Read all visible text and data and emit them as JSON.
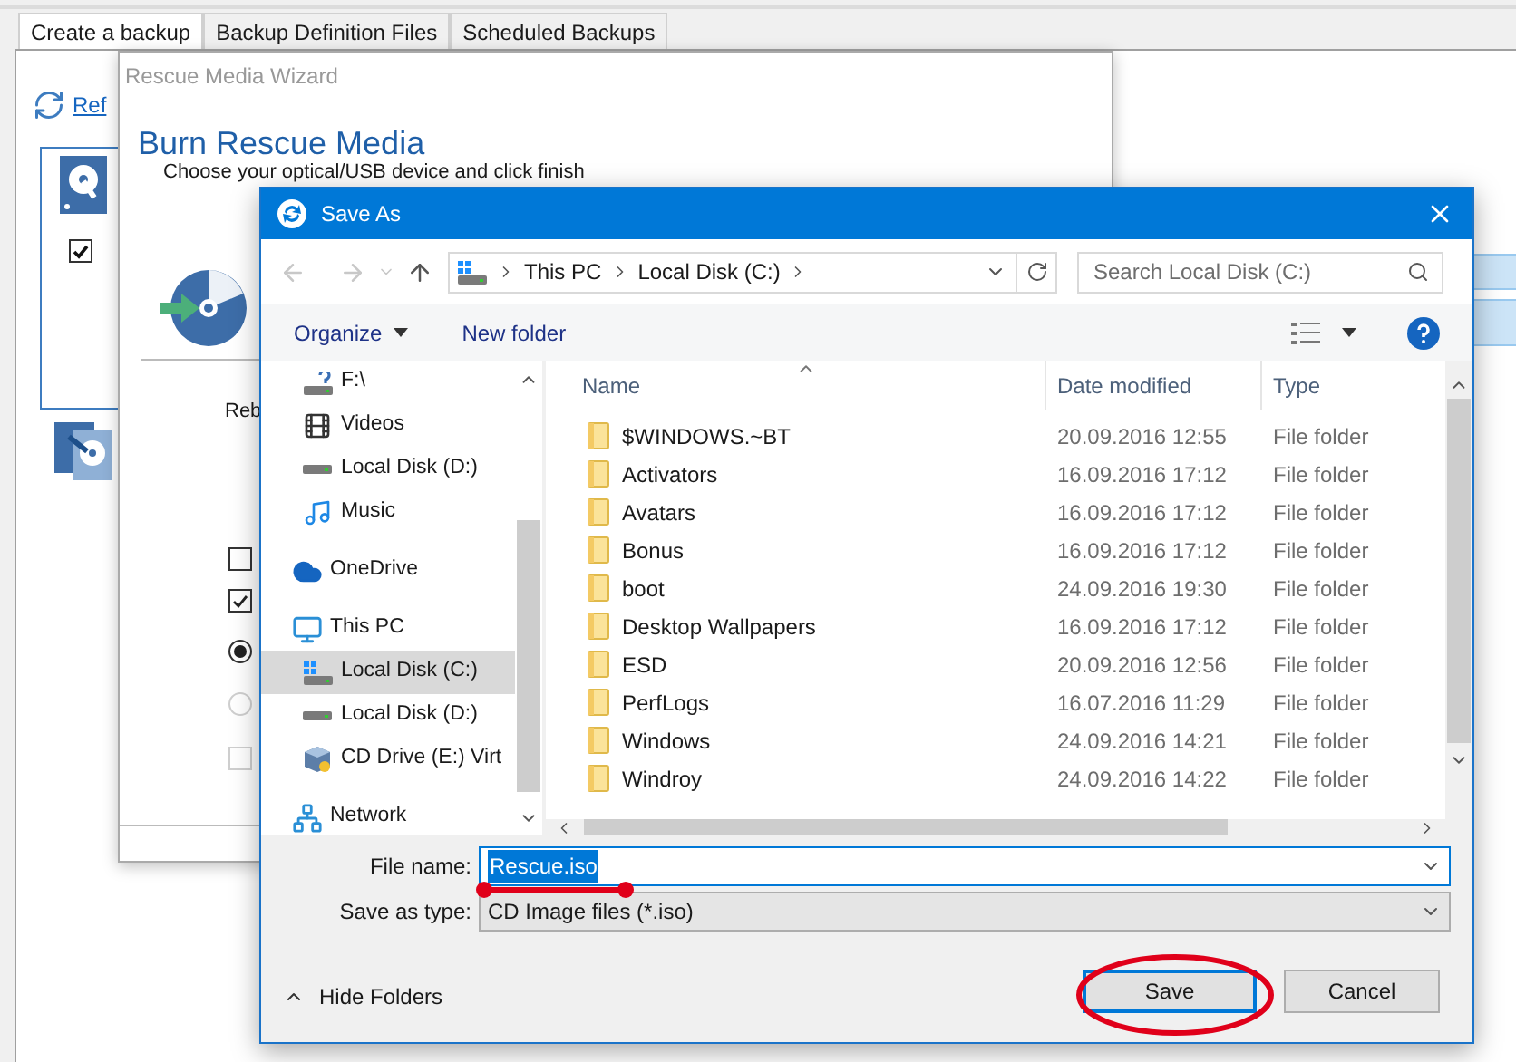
{
  "app": {
    "tabs": [
      {
        "label": "Create a backup",
        "selected": true
      },
      {
        "label": "Backup Definition Files",
        "selected": false
      },
      {
        "label": "Scheduled Backups",
        "selected": false
      }
    ],
    "refresh_link": "Ref",
    "image_checkbox": {
      "checked": true
    }
  },
  "wizard": {
    "title": "Rescue Media Wizard",
    "heading": "Burn Rescue Media",
    "instruction": "Choose your optical/USB device and click finish",
    "partial_label": "Reb",
    "options": [
      {
        "kind": "checkbox",
        "checked": false,
        "disabled": false
      },
      {
        "kind": "checkbox",
        "checked": true,
        "disabled": false
      },
      {
        "kind": "radio",
        "checked": true,
        "disabled": false
      },
      {
        "kind": "radio",
        "checked": false,
        "disabled": true
      },
      {
        "kind": "checkbox",
        "checked": false,
        "disabled": true
      }
    ]
  },
  "save_dialog": {
    "title": "Save As",
    "breadcrumb": [
      "This PC",
      "Local Disk (C:)"
    ],
    "search": {
      "placeholder": "Search Local Disk (C:)"
    },
    "toolbar": {
      "organize": "Organize",
      "new_folder": "New folder"
    },
    "nav_pane": {
      "scrolled_children": [
        {
          "label": "F:\\",
          "kind": "usb",
          "selected": false
        },
        {
          "label": "Videos",
          "kind": "videos",
          "selected": false
        },
        {
          "label": "Local Disk (D:)",
          "kind": "drive",
          "selected": false
        },
        {
          "label": "Music",
          "kind": "music",
          "selected": false
        }
      ],
      "items": [
        {
          "label": "OneDrive",
          "kind": "cloud",
          "selected": false
        },
        {
          "label": "This PC",
          "kind": "computer",
          "selected": false,
          "children": [
            {
              "label": "Local Disk (C:)",
              "kind": "system-drive",
              "selected": true
            },
            {
              "label": "Local Disk (D:)",
              "kind": "drive",
              "selected": false
            },
            {
              "label": "CD Drive (E:) Virt",
              "kind": "cd",
              "selected": false
            }
          ]
        },
        {
          "label": "Network",
          "kind": "network",
          "selected": false
        }
      ]
    },
    "columns": [
      "Name",
      "Date modified",
      "Type"
    ],
    "rows": [
      {
        "name": "$WINDOWS.~BT",
        "date": "20.09.2016 12:55",
        "type": "File folder"
      },
      {
        "name": "Activators",
        "date": "16.09.2016 17:12",
        "type": "File folder"
      },
      {
        "name": "Avatars",
        "date": "16.09.2016 17:12",
        "type": "File folder"
      },
      {
        "name": "Bonus",
        "date": "16.09.2016 17:12",
        "type": "File folder"
      },
      {
        "name": "boot",
        "date": "24.09.2016 19:30",
        "type": "File folder"
      },
      {
        "name": "Desktop Wallpapers",
        "date": "16.09.2016 17:12",
        "type": "File folder"
      },
      {
        "name": "ESD",
        "date": "20.09.2016 12:56",
        "type": "File folder"
      },
      {
        "name": "PerfLogs",
        "date": "16.07.2016 11:29",
        "type": "File folder"
      },
      {
        "name": "Windows",
        "date": "24.09.2016 14:21",
        "type": "File folder"
      },
      {
        "name": "Windroy",
        "date": "24.09.2016 14:22",
        "type": "File folder"
      }
    ],
    "file_name": {
      "label": "File name:",
      "value": "Rescue.iso"
    },
    "save_as_type": {
      "label": "Save as type:",
      "value": "CD Image files (*.iso)"
    },
    "hide_folders": "Hide Folders",
    "buttons": [
      "Save",
      "Cancel"
    ]
  }
}
